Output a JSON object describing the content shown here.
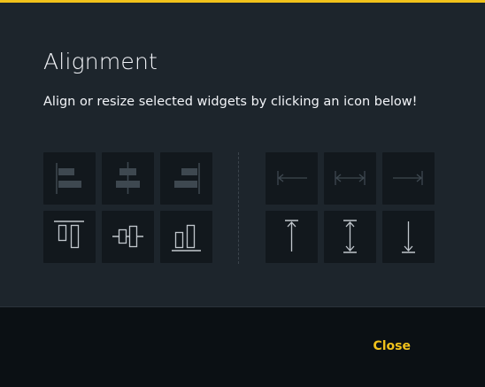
{
  "dialog": {
    "title": "Alignment",
    "subtitle": "Align or resize selected widgets by clicking an icon below!"
  },
  "alignment_groups": {
    "horizontal_align": [
      {
        "icon": "align-left-icon",
        "enabled": false
      },
      {
        "icon": "align-center-horizontal-icon",
        "enabled": false
      },
      {
        "icon": "align-right-icon",
        "enabled": false
      }
    ],
    "vertical_align": [
      {
        "icon": "align-top-icon",
        "enabled": true
      },
      {
        "icon": "align-middle-vertical-icon",
        "enabled": true
      },
      {
        "icon": "align-bottom-icon",
        "enabled": true
      }
    ],
    "horizontal_resize": [
      {
        "icon": "resize-to-left-icon",
        "enabled": false
      },
      {
        "icon": "resize-width-icon",
        "enabled": false
      },
      {
        "icon": "resize-to-right-icon",
        "enabled": false
      }
    ],
    "vertical_resize": [
      {
        "icon": "resize-to-top-icon",
        "enabled": true
      },
      {
        "icon": "resize-height-icon",
        "enabled": true
      },
      {
        "icon": "resize-to-bottom-icon",
        "enabled": true
      }
    ]
  },
  "footer": {
    "close_label": "Close"
  },
  "colors": {
    "accent": "#f1c21b",
    "background": "#1d252c",
    "tile": "#12181d",
    "icon_enabled": "#c1c7cd",
    "icon_disabled": "#3e4850",
    "footer": "#0b1014"
  }
}
